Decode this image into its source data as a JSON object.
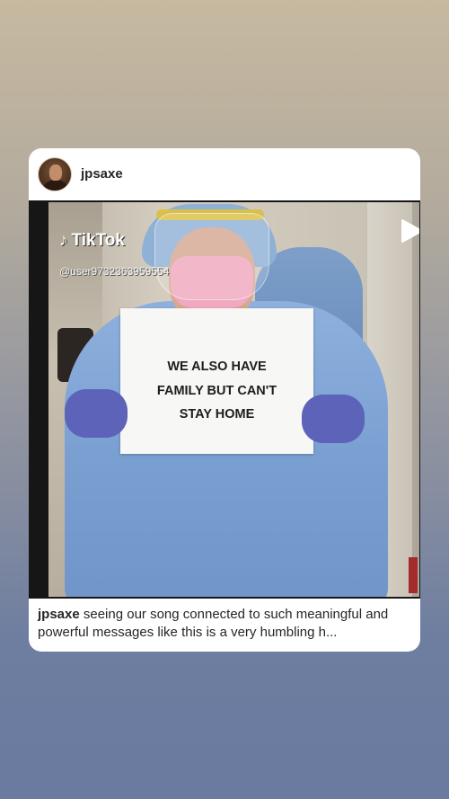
{
  "post": {
    "username": "jpsaxe",
    "caption_user": "jpsaxe",
    "caption_text": "seeing our song connected to such meaningful and powerful messages like this is a very humbling h..."
  },
  "media": {
    "watermark_brand": "TikTok",
    "watermark_user": "@user9732363959554",
    "sign_lines": [
      "WE ALSO HAVE",
      "FAMILY BUT CAN'T",
      "STAY HOME"
    ],
    "play_icon": "play-icon"
  },
  "colors": {
    "background_top": "#c7b9a0",
    "background_bottom": "#6a7aa0",
    "card": "#ffffff",
    "text": "#262626",
    "gown": "#7aa0d2",
    "mask": "#f0a9bf",
    "gloves": "#5d63b8"
  }
}
